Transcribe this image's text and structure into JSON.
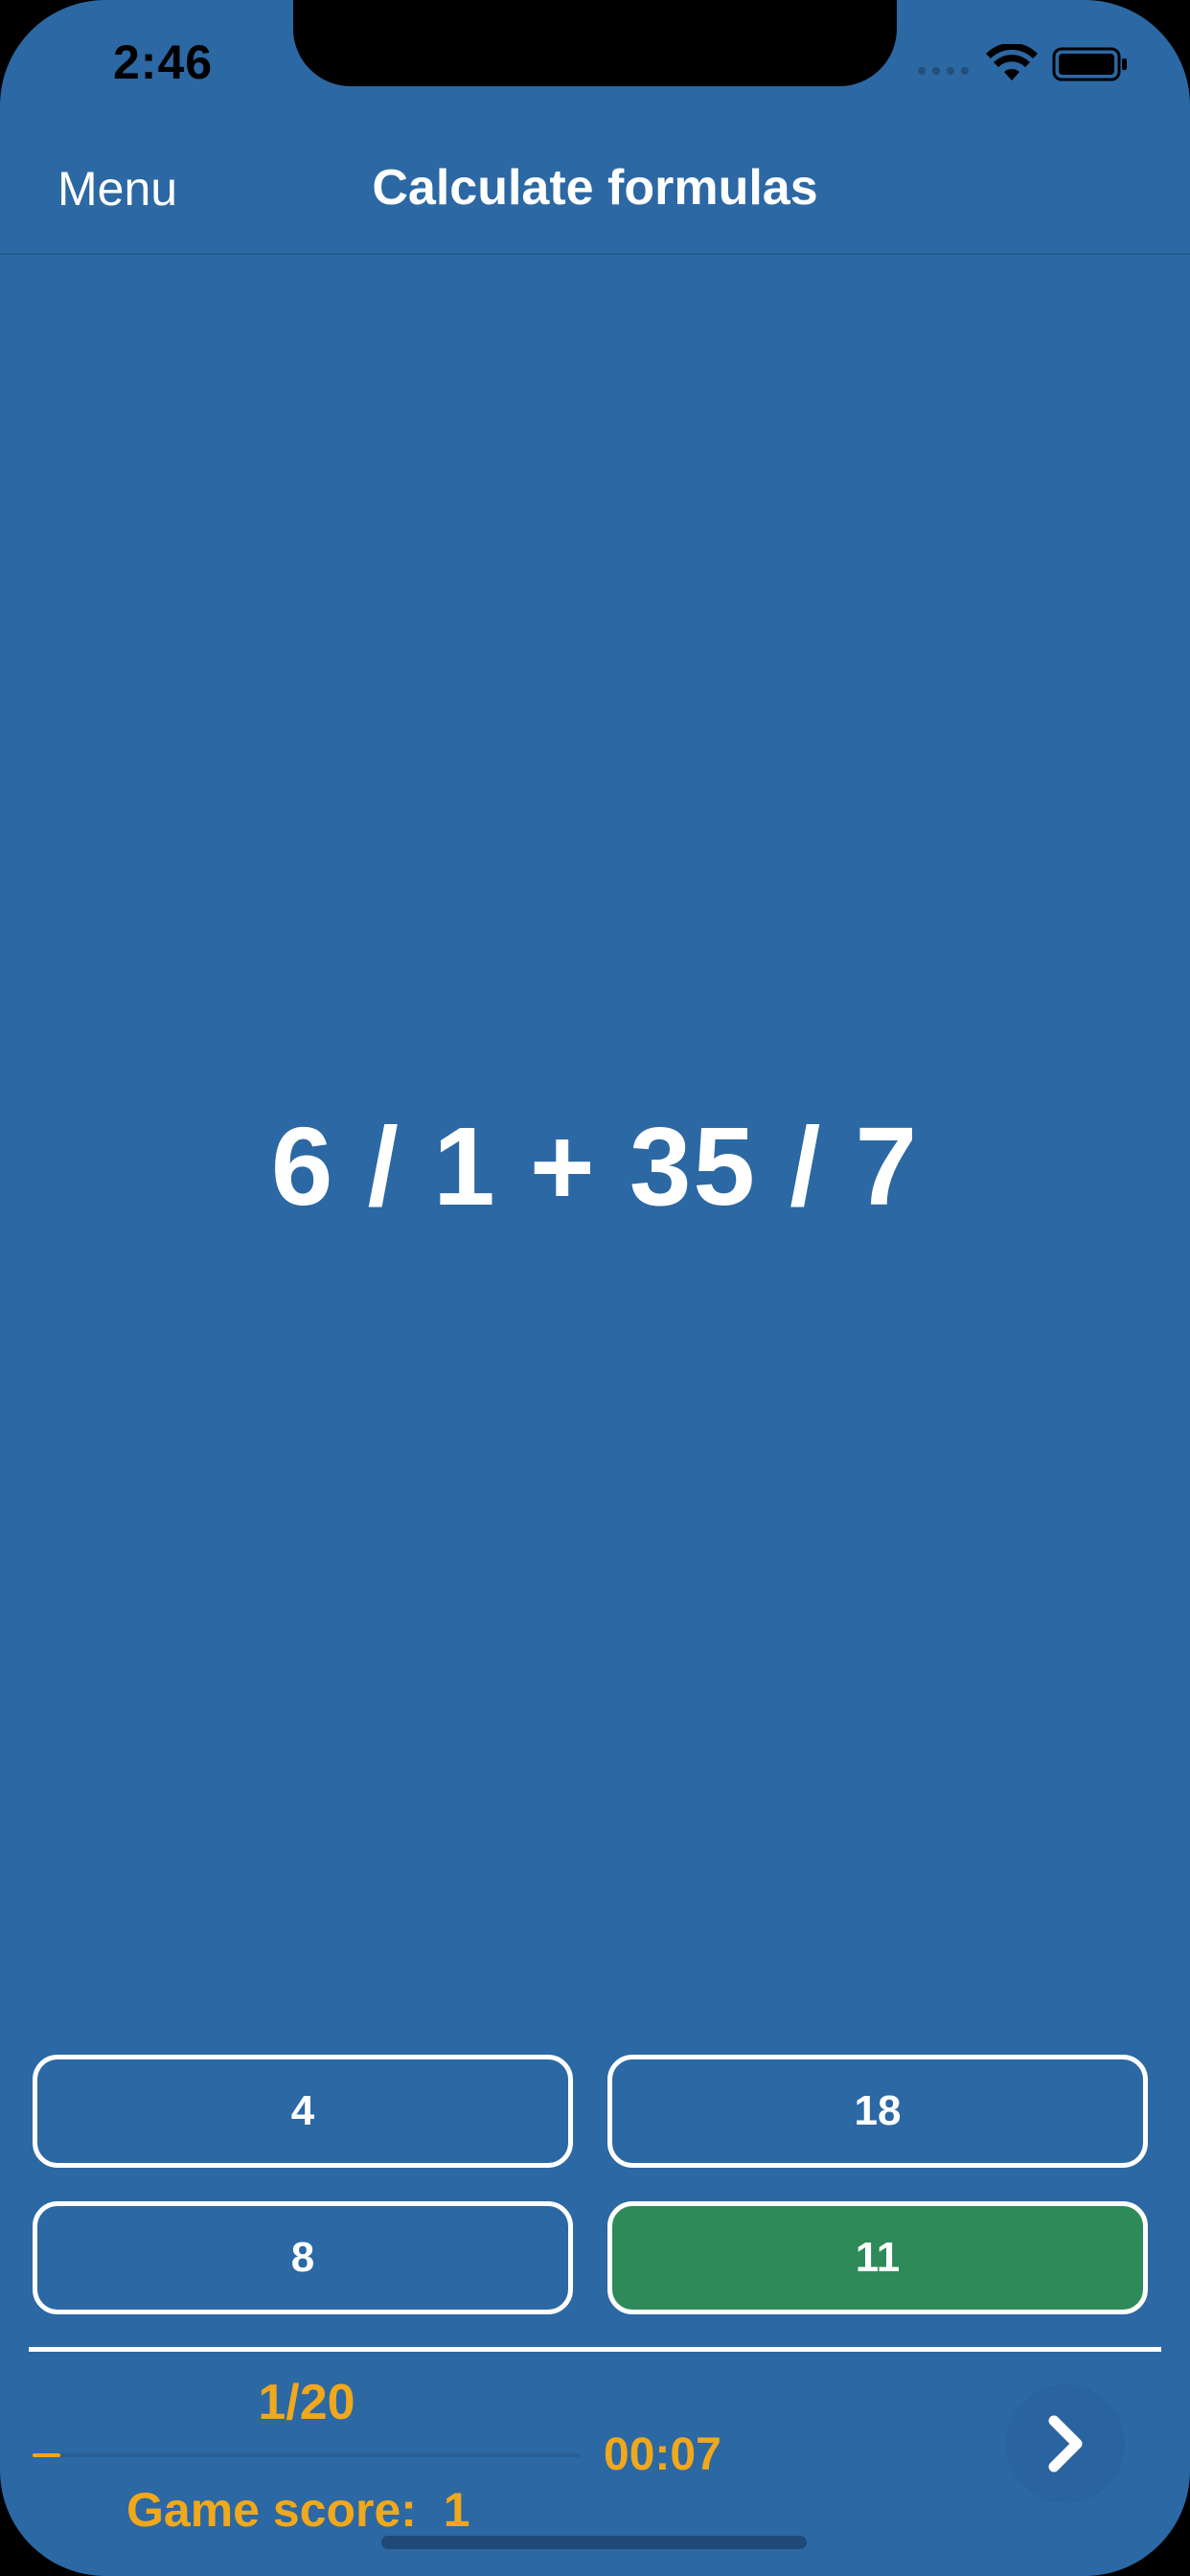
{
  "status_bar": {
    "time": "2:46"
  },
  "nav": {
    "menu_label": "Menu",
    "title": "Calculate formulas"
  },
  "quiz": {
    "formula": "6 / 1 + 35 / 7",
    "answers": [
      {
        "label": "4",
        "state": "default"
      },
      {
        "label": "18",
        "state": "default"
      },
      {
        "label": "8",
        "state": "default"
      },
      {
        "label": "11",
        "state": "correct"
      }
    ]
  },
  "footer": {
    "progress_text": "1/20",
    "progress_fraction": 0.05,
    "timer": "00:07",
    "score_label": "Game score:",
    "score_value": "1"
  },
  "colors": {
    "background": "#2c68a3",
    "accent_orange": "#f0a81c",
    "correct_green": "#2f8a59",
    "text": "#ffffff"
  },
  "icons": {
    "wifi": "wifi-icon",
    "battery": "battery-icon",
    "next": "chevron-right-icon"
  }
}
